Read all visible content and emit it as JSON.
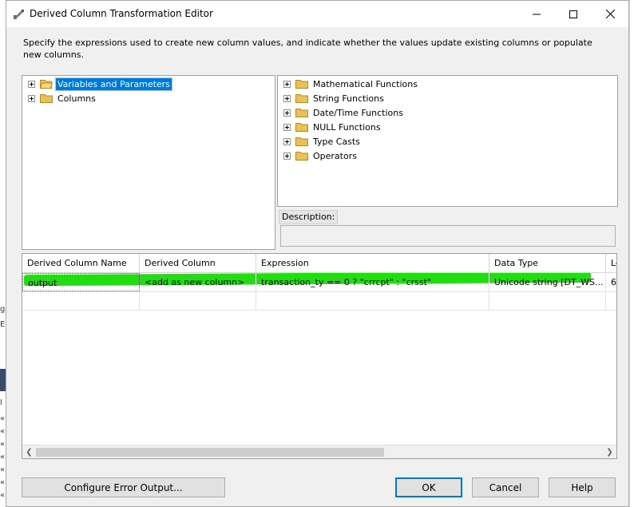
{
  "window": {
    "title": "Derived Column Transformation Editor"
  },
  "instruction": "Specify the expressions used to create new column values, and indicate whether the values update existing columns or populate new columns.",
  "left_tree": [
    {
      "label": "Variables and Parameters",
      "selected": true,
      "open_folder": true
    },
    {
      "label": "Columns",
      "selected": false,
      "open_folder": false
    }
  ],
  "right_tree": [
    {
      "label": "Mathematical Functions"
    },
    {
      "label": "String Functions"
    },
    {
      "label": "Date/Time Functions"
    },
    {
      "label": "NULL Functions"
    },
    {
      "label": "Type Casts"
    },
    {
      "label": "Operators"
    }
  ],
  "description": {
    "label": "Description:",
    "value": ""
  },
  "grid": {
    "columns": [
      "Derived Column Name",
      "Derived Column",
      "Expression",
      "Data Type",
      "Le"
    ],
    "rows": [
      [
        "output",
        "<add as new column>",
        "transaction_ty == 0 ? \"crrcpt\" : \"crsst\"",
        "Unicode string [DT_WS...",
        "6"
      ]
    ]
  },
  "buttons": {
    "configure_error": "Configure Error Output...",
    "ok": "OK",
    "cancel": "Cancel",
    "help": "Help"
  },
  "colors": {
    "selection": "#0078d7",
    "highlight_marker": "#22dd11",
    "folder": "#e8c15a"
  }
}
